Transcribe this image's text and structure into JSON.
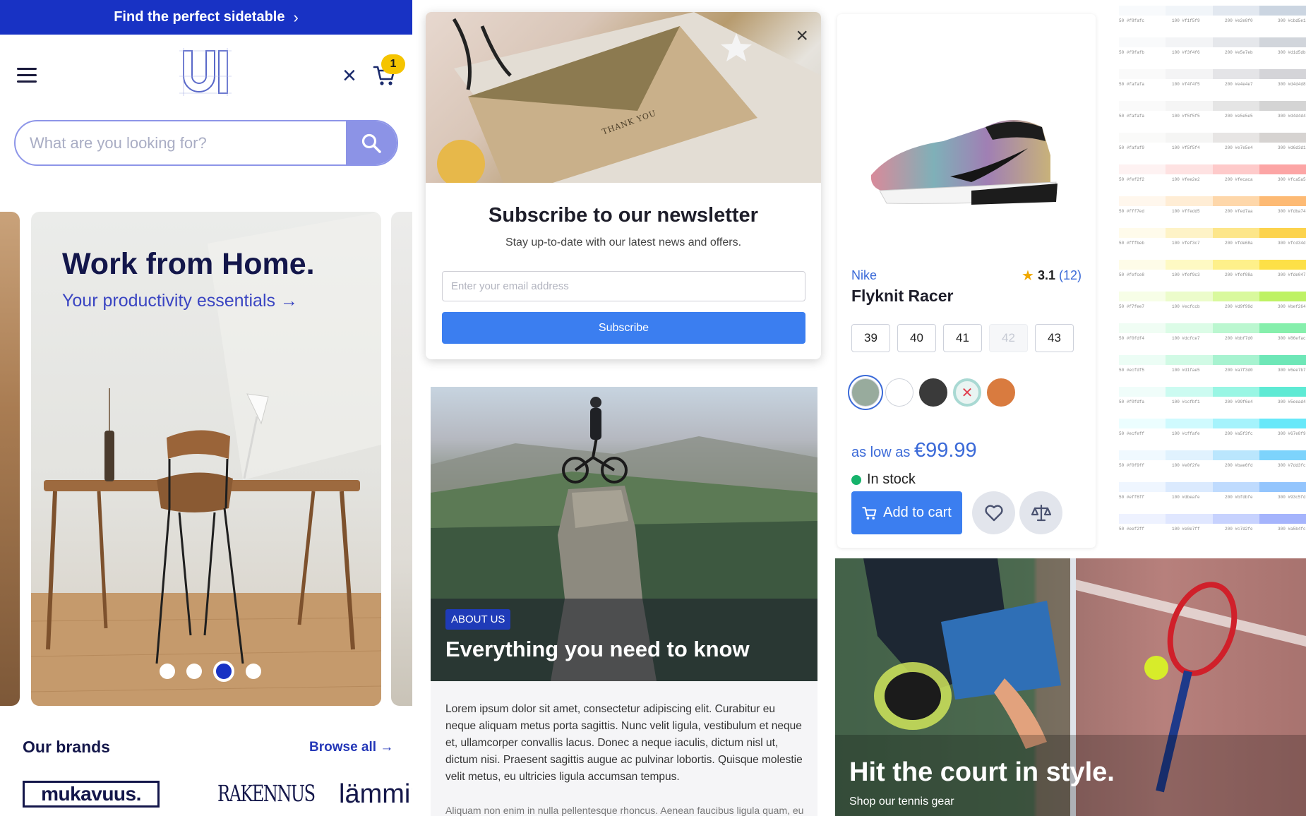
{
  "shop": {
    "promo_text": "Find the perfect sidetable",
    "cart_count": "1",
    "search_placeholder": "What are you looking for?",
    "hero": {
      "title": "Work from Home.",
      "subtitle": "Your productivity essentials →",
      "dots": 4,
      "active_dot": 3
    },
    "brands": {
      "title": "Our brands",
      "browse_all": "Browse all →",
      "items": [
        "mukavuus.",
        "RAKENNUS",
        "lämmin"
      ]
    },
    "colors": {
      "primary": "#1832c4",
      "search_button": "#8c93e6",
      "badge": "#f5c400"
    }
  },
  "newsletter": {
    "title": "Subscribe to our newsletter",
    "subtitle": "Stay up-to-date with our latest news and offers.",
    "email_placeholder": "Enter your email address",
    "button": "Subscribe",
    "card_text": "THANK YOU"
  },
  "about": {
    "tag": "ABOUT US",
    "title": "Everything you need to know",
    "body": "Lorem ipsum dolor sit amet, consectetur adipiscing elit. Curabitur eu neque aliquam metus porta sagittis. Nunc velit ligula, vestibulum et neque et, ullamcorper convallis lacus. Donec a neque iaculis, dictum nisl ut, dictum nisi. Praesent sagittis augue ac pulvinar lobortis. Quisque molestie velit metus, eu ultricies ligula accumsan tempus.",
    "body2": "Aliquam non enim in nulla pellentesque rhoncus. Aenean faucibus ligula quam, eu"
  },
  "product": {
    "brand": "Nike",
    "name": "Flyknit Racer",
    "rating": "3.1",
    "reviews": "(12)",
    "sizes": [
      {
        "label": "39",
        "available": true
      },
      {
        "label": "40",
        "available": true
      },
      {
        "label": "41",
        "available": true
      },
      {
        "label": "42",
        "available": false
      },
      {
        "label": "43",
        "available": true
      }
    ],
    "swatches": [
      {
        "color": "#98ab9d",
        "selected": true,
        "available": true
      },
      {
        "color": "#ffffff",
        "selected": false,
        "available": true
      },
      {
        "color": "#3a3a3a",
        "selected": false,
        "available": true
      },
      {
        "color": "#a9d9d3",
        "selected": false,
        "available": false
      },
      {
        "color": "#d97b3f",
        "selected": false,
        "available": true
      }
    ],
    "price_prefix": "as low as",
    "price": "€99.99",
    "stock": "In stock",
    "add_to_cart": "Add to cart"
  },
  "tennis": {
    "title": "Hit the court in style.",
    "subtitle": "Shop our tennis gear"
  },
  "palette": {
    "steps": [
      "50",
      "100",
      "200",
      "300"
    ],
    "rows": [
      {
        "hex": [
          "#f8fafc",
          "#f1f5f9",
          "#e2e8f0",
          "#cbd5e1"
        ]
      },
      {
        "hex": [
          "#f9fafb",
          "#f3f4f6",
          "#e5e7eb",
          "#d1d5db"
        ]
      },
      {
        "hex": [
          "#fafafa",
          "#f4f4f5",
          "#e4e4e7",
          "#d4d4d8"
        ]
      },
      {
        "hex": [
          "#fafafa",
          "#f5f5f5",
          "#e5e5e5",
          "#d4d4d4"
        ]
      },
      {
        "hex": [
          "#fafaf9",
          "#f5f5f4",
          "#e7e5e4",
          "#d6d3d1"
        ]
      },
      {
        "hex": [
          "#fef2f2",
          "#fee2e2",
          "#fecaca",
          "#fca5a5"
        ]
      },
      {
        "hex": [
          "#fff7ed",
          "#ffedd5",
          "#fed7aa",
          "#fdba74"
        ]
      },
      {
        "hex": [
          "#fffbeb",
          "#fef3c7",
          "#fde68a",
          "#fcd34d"
        ]
      },
      {
        "hex": [
          "#fefce8",
          "#fef9c3",
          "#fef08a",
          "#fde047"
        ]
      },
      {
        "hex": [
          "#f7fee7",
          "#ecfccb",
          "#d9f99d",
          "#bef264"
        ]
      },
      {
        "hex": [
          "#f0fdf4",
          "#dcfce7",
          "#bbf7d0",
          "#86efac"
        ]
      },
      {
        "hex": [
          "#ecfdf5",
          "#d1fae5",
          "#a7f3d0",
          "#6ee7b7"
        ]
      },
      {
        "hex": [
          "#f0fdfa",
          "#ccfbf1",
          "#99f6e4",
          "#5eead4"
        ]
      },
      {
        "hex": [
          "#ecfeff",
          "#cffafe",
          "#a5f3fc",
          "#67e8f9"
        ]
      },
      {
        "hex": [
          "#f0f9ff",
          "#e0f2fe",
          "#bae6fd",
          "#7dd3fc"
        ]
      },
      {
        "hex": [
          "#eff6ff",
          "#dbeafe",
          "#bfdbfe",
          "#93c5fd"
        ]
      },
      {
        "hex": [
          "#eef2ff",
          "#e0e7ff",
          "#c7d2fe",
          "#a5b4fc"
        ]
      }
    ]
  }
}
